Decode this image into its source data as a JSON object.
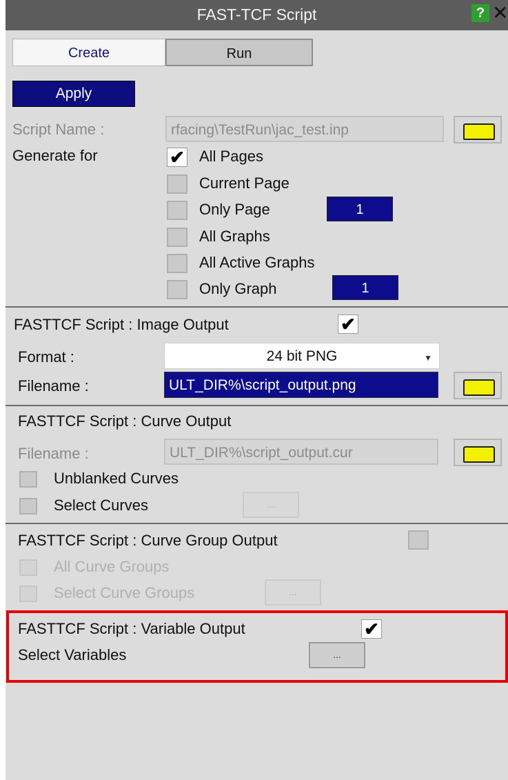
{
  "window": {
    "title": "FAST-TCF Script",
    "help_label": "?",
    "close_label": "✕"
  },
  "tabs": [
    {
      "label": "Create"
    },
    {
      "label": "Run"
    }
  ],
  "apply_label": "Apply",
  "script_name": {
    "label": "Script Name :",
    "value": "rfacing\\TestRun\\jac_test.inp"
  },
  "generate_for": {
    "label": "Generate for",
    "options": [
      {
        "label": "All Pages",
        "checked": true
      },
      {
        "label": "Current Page",
        "checked": false
      },
      {
        "label": "Only Page",
        "checked": false,
        "value": "1"
      },
      {
        "label": "All Graphs",
        "checked": false
      },
      {
        "label": "All Active Graphs",
        "checked": false
      },
      {
        "label": "Only Graph",
        "checked": false,
        "value": "1"
      }
    ]
  },
  "image_output": {
    "heading": "FASTTCF Script : Image Output",
    "enabled": true,
    "format_label": "Format :",
    "format_value": "24 bit PNG",
    "filename_label": "Filename :",
    "filename_value": "ULT_DIR%\\script_output.png"
  },
  "curve_output": {
    "heading": "FASTTCF Script : Curve Output",
    "filename_label": "Filename :",
    "filename_value": "ULT_DIR%\\script_output.cur",
    "options": [
      {
        "label": "Unblanked Curves"
      },
      {
        "label": "Select Curves"
      }
    ],
    "select_button": "..."
  },
  "curve_group_output": {
    "heading": "FASTTCF Script : Curve Group Output",
    "options": [
      {
        "label": "All Curve Groups"
      },
      {
        "label": "Select Curve Groups"
      }
    ],
    "select_button": "..."
  },
  "variable_output": {
    "heading": "FASTTCF Script : Variable Output",
    "enabled": true,
    "select_label": "Select Variables",
    "select_button": "..."
  },
  "colors": {
    "highlight_border": "#e60000",
    "selection_blue": "#0c0c8c",
    "folder_yellow": "#f2f200"
  },
  "icons": {
    "folder": "folder-icon",
    "help": "help-icon",
    "close": "close-icon",
    "check": "checkmark-icon"
  }
}
